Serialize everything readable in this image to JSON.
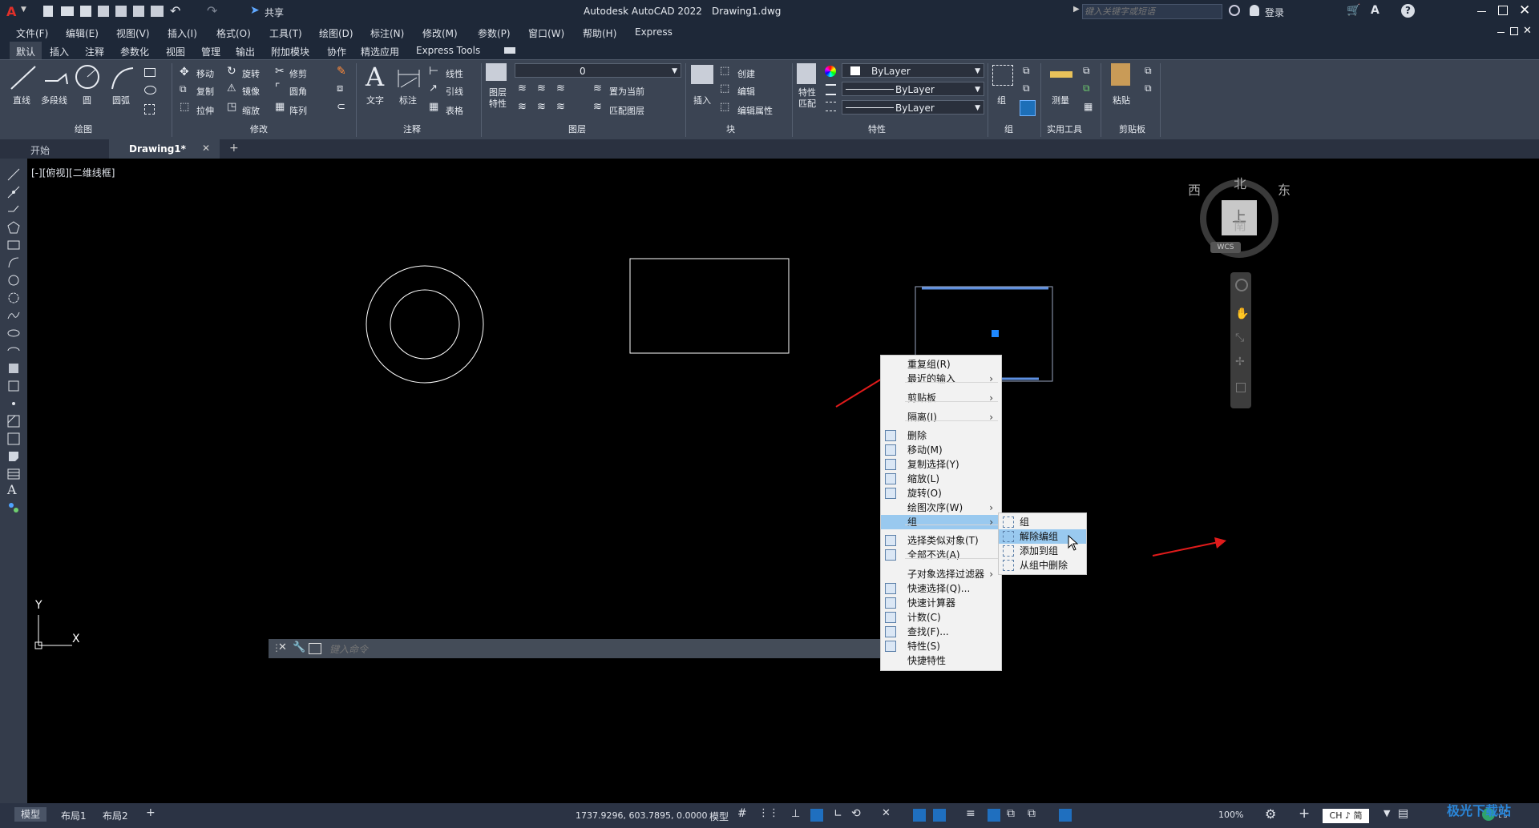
{
  "titlebar": {
    "app_title": "Autodesk AutoCAD 2022",
    "file_name": "Drawing1.dwg",
    "share_label": "共享",
    "search_placeholder": "键入关键字或短语",
    "login_label": "登录"
  },
  "menubar": {
    "items": [
      "文件(F)",
      "编辑(E)",
      "视图(V)",
      "插入(I)",
      "格式(O)",
      "工具(T)",
      "绘图(D)",
      "标注(N)",
      "修改(M)",
      "参数(P)",
      "窗口(W)",
      "帮助(H)",
      "Express"
    ]
  },
  "ribbon_tabs": [
    "默认",
    "插入",
    "注释",
    "参数化",
    "视图",
    "管理",
    "输出",
    "附加模块",
    "协作",
    "精选应用",
    "Express Tools"
  ],
  "ribbon": {
    "draw": {
      "line": "直线",
      "polyline": "多段线",
      "circle": "圆",
      "arc": "圆弧",
      "panel": "绘图"
    },
    "modify": {
      "move": "移动",
      "rotate": "旋转",
      "trim": "修剪",
      "copy": "复制",
      "mirror": "镜像",
      "fillet": "圆角",
      "stretch": "拉伸",
      "scale": "缩放",
      "array": "阵列",
      "panel": "修改"
    },
    "annotation": {
      "text": "文字",
      "dimension": "标注",
      "linear": "线性",
      "leader": "引线",
      "table": "表格",
      "panel": "注释"
    },
    "layers": {
      "layer_props_1": "图层",
      "layer_props_2": "特性",
      "current_layer": "0",
      "make_current": "置为当前",
      "match_layer": "匹配图层",
      "panel": "图层"
    },
    "block": {
      "insert": "插入",
      "create": "创建",
      "edit": "编辑",
      "edit_attr": "编辑属性",
      "panel": "块"
    },
    "properties": {
      "match_1": "特性",
      "match_2": "匹配",
      "color": "ByLayer",
      "linetype": "ByLayer",
      "lineweight": "ByLayer",
      "panel": "特性"
    },
    "groups": {
      "group": "组",
      "panel": "组"
    },
    "utilities": {
      "measure": "测量",
      "panel": "实用工具"
    },
    "clipboard": {
      "paste": "粘贴",
      "panel": "剪贴板"
    }
  },
  "file_tabs": {
    "start": "开始",
    "drawing": "Drawing1*",
    "add": "+"
  },
  "viewport_label": "[-][俯视][二维线框]",
  "viewcube": {
    "north": "北",
    "south": "南",
    "east": "东",
    "west": "西",
    "top": "上",
    "wcs": "WCS"
  },
  "ucs": {
    "x": "X",
    "y": "Y"
  },
  "command_placeholder": "键入命令",
  "context_menu": {
    "items": [
      {
        "label": "重复组(R)",
        "submenu": false,
        "icon": ""
      },
      {
        "label": "最近的输入",
        "submenu": true,
        "icon": ""
      },
      {
        "label": "剪贴板",
        "submenu": true,
        "icon": ""
      },
      {
        "label": "隔离(I)",
        "submenu": true,
        "icon": ""
      },
      {
        "label": "删除",
        "submenu": false,
        "icon": "eraser-icon"
      },
      {
        "label": "移动(M)",
        "submenu": false,
        "icon": "move-icon"
      },
      {
        "label": "复制选择(Y)",
        "submenu": false,
        "icon": "copy-icon"
      },
      {
        "label": "缩放(L)",
        "submenu": false,
        "icon": "scale-icon"
      },
      {
        "label": "旋转(O)",
        "submenu": false,
        "icon": "rotate-icon"
      },
      {
        "label": "绘图次序(W)",
        "submenu": true,
        "icon": ""
      },
      {
        "label": "组",
        "submenu": true,
        "icon": ""
      },
      {
        "label": "选择类似对象(T)",
        "submenu": false,
        "icon": "select-similar-icon"
      },
      {
        "label": "全部不选(A)",
        "submenu": false,
        "icon": "deselect-icon"
      },
      {
        "label": "子对象选择过滤器",
        "submenu": true,
        "icon": ""
      },
      {
        "label": "快速选择(Q)...",
        "submenu": false,
        "icon": "quick-select-icon"
      },
      {
        "label": "快速计算器",
        "submenu": false,
        "icon": "calculator-icon"
      },
      {
        "label": "计数(C)",
        "submenu": false,
        "icon": "count-icon"
      },
      {
        "label": "查找(F)...",
        "submenu": false,
        "icon": "find-icon"
      },
      {
        "label": "特性(S)",
        "submenu": false,
        "icon": "properties-icon"
      },
      {
        "label": "快捷特性",
        "submenu": false,
        "icon": ""
      }
    ],
    "group_submenu": [
      "组",
      "解除编组",
      "添加到组",
      "从组中删除"
    ]
  },
  "statusbar": {
    "model_tab": "模型",
    "layout1": "布局1",
    "layout2": "布局2",
    "coords": "1737.9296, 603.7895, 0.0000",
    "model_label": "模型",
    "zoom": "100%",
    "ime": "CH ♪ 简"
  },
  "watermark": "极光下载站",
  "colors": {
    "titlebar": "#1e2838",
    "ribbon": "#3b4453",
    "highlight": "#99c9ef",
    "grip": "#1e88ff",
    "annotation_arrow": "#e01b1b"
  }
}
